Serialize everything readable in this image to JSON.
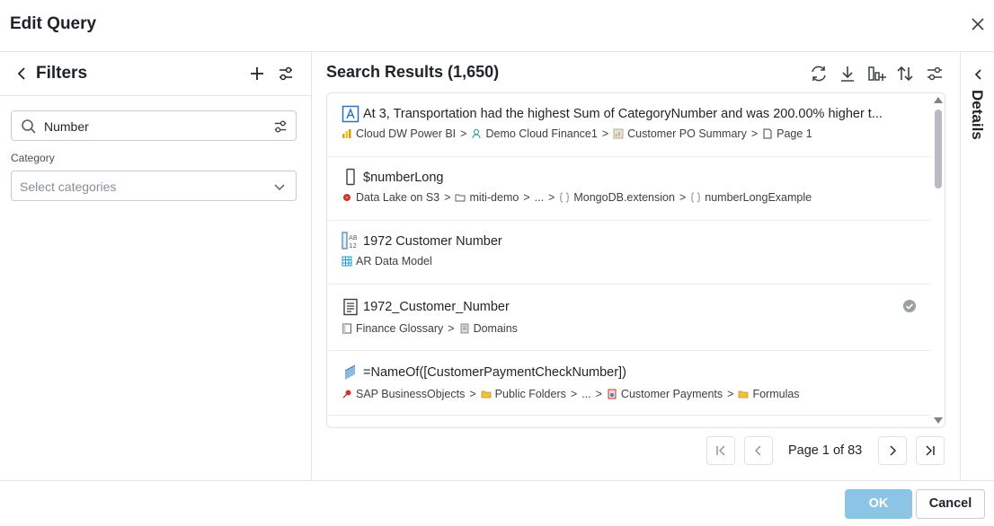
{
  "dialog": {
    "title": "Edit Query",
    "ok_label": "OK",
    "cancel_label": "Cancel"
  },
  "filters": {
    "title": "Filters",
    "search_value": "Number",
    "category_label": "Category",
    "category_placeholder": "Select categories"
  },
  "results": {
    "title": "Search Results (1,650)",
    "items": [
      {
        "title": "At 3, Transportation had the highest Sum of CategoryNumber and was 200.00% higher t...",
        "icon": "insight-icon",
        "path": [
          "Cloud DW Power BI",
          "Demo Cloud Finance1",
          "Customer PO Summary",
          "Page 1"
        ],
        "verified": false
      },
      {
        "title": "$numberLong",
        "icon": "field-icon",
        "path": [
          "Data Lake on S3",
          "miti-demo",
          "...",
          "MongoDB.extension",
          "numberLongExample"
        ],
        "verified": false
      },
      {
        "title": "1972 Customer Number",
        "icon": "attribute-icon",
        "path": [
          "AR Data Model"
        ],
        "verified": false
      },
      {
        "title": "1972_Customer_Number",
        "icon": "glossary-term-icon",
        "path": [
          "Finance Glossary",
          "Domains"
        ],
        "verified": true
      },
      {
        "title": "=NameOf([CustomerPaymentCheckNumber])",
        "icon": "formula-icon",
        "path": [
          "SAP BusinessObjects",
          "Public Folders",
          "...",
          "Customer Payments",
          "Formulas"
        ],
        "verified": false
      }
    ]
  },
  "pagination": {
    "label": "Page 1 of 83"
  },
  "details": {
    "label": "Details"
  },
  "colors": {
    "ok_button": "#8cc4e6",
    "border": "#e3e5e8",
    "scroll_thumb": "#b8bcc2"
  }
}
